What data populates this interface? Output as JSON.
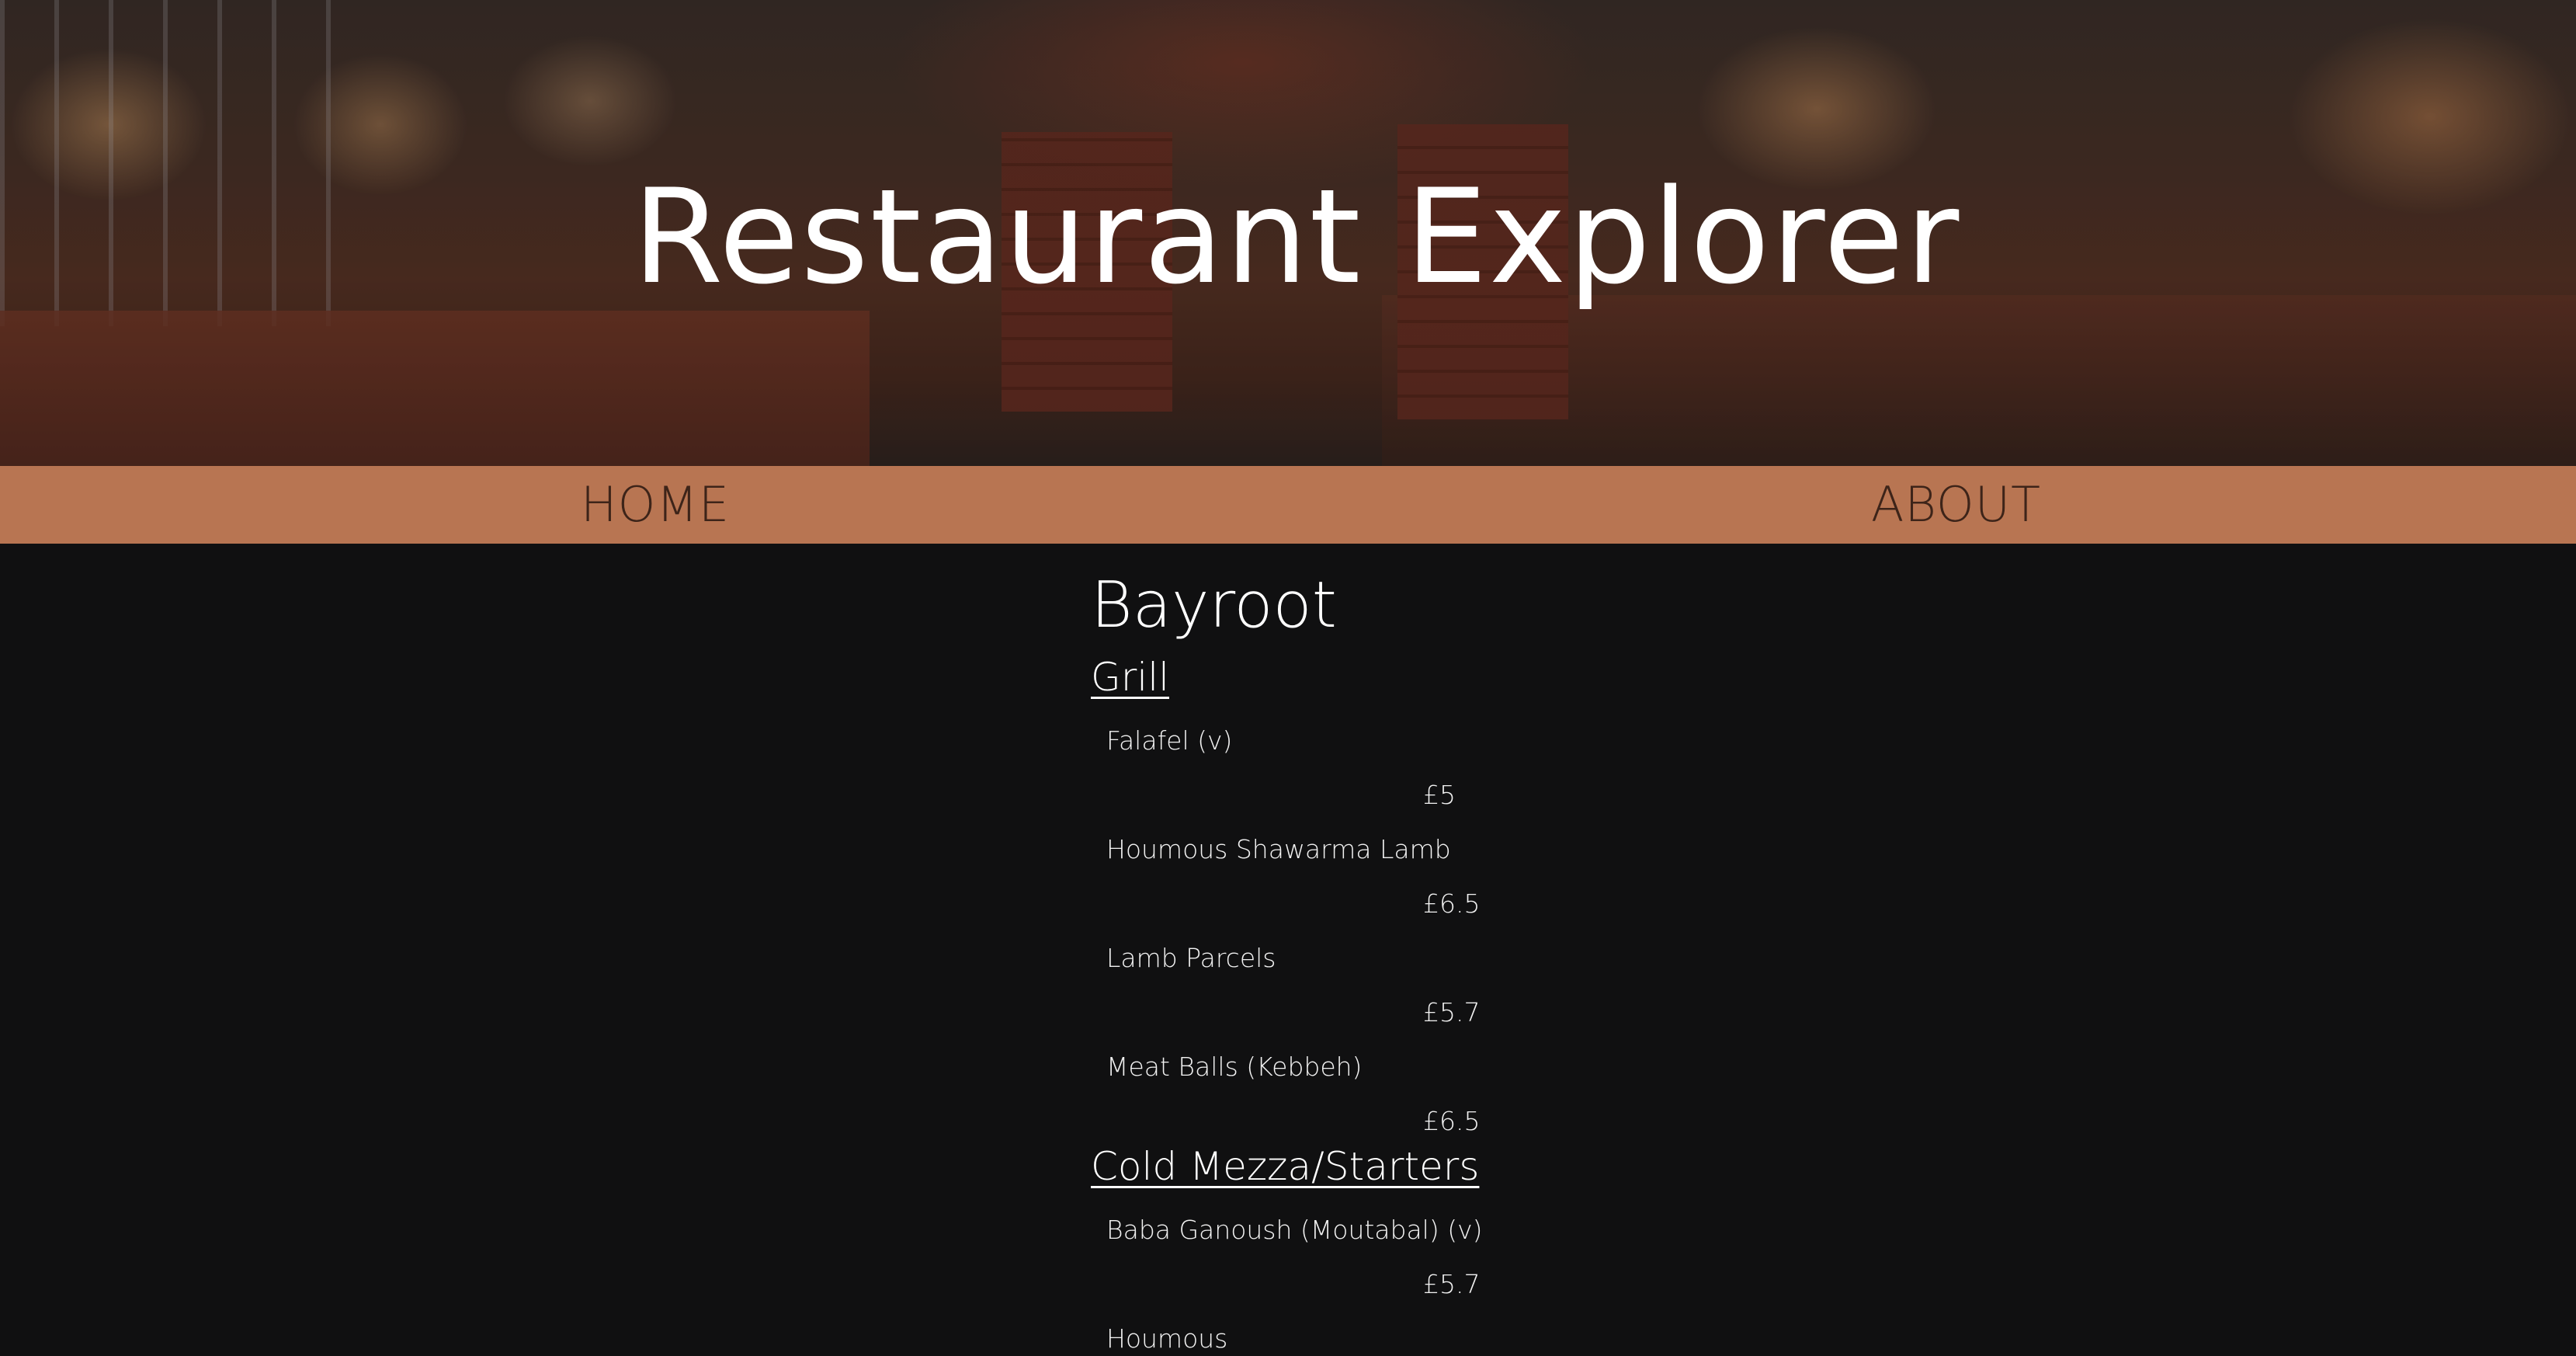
{
  "header": {
    "title": "Restaurant Explorer",
    "hero_image": "restaurant-interior-photo"
  },
  "nav": {
    "home_label": "HOME",
    "about_label": "ABOUT"
  },
  "colors": {
    "nav_background": "#b87552",
    "page_background": "#101011",
    "text": "#ffffff"
  },
  "restaurant": {
    "name": "Bayroot",
    "sections": [
      {
        "title": "Grill",
        "items": [
          {
            "name": "Falafel (v)",
            "price": "£5"
          },
          {
            "name": "Houmous Shawarma Lamb",
            "price": "£6.5"
          },
          {
            "name": "Lamb Parcels",
            "price": "£5.7"
          },
          {
            "name": "Meat Balls (Kebbeh)",
            "price": "£6.5"
          }
        ]
      },
      {
        "title": "Cold Mezza/Starters",
        "items": [
          {
            "name": "Baba Ganoush (Moutabal) (v)",
            "price": "£5.7"
          },
          {
            "name": "Houmous",
            "price": ""
          }
        ]
      }
    ]
  }
}
